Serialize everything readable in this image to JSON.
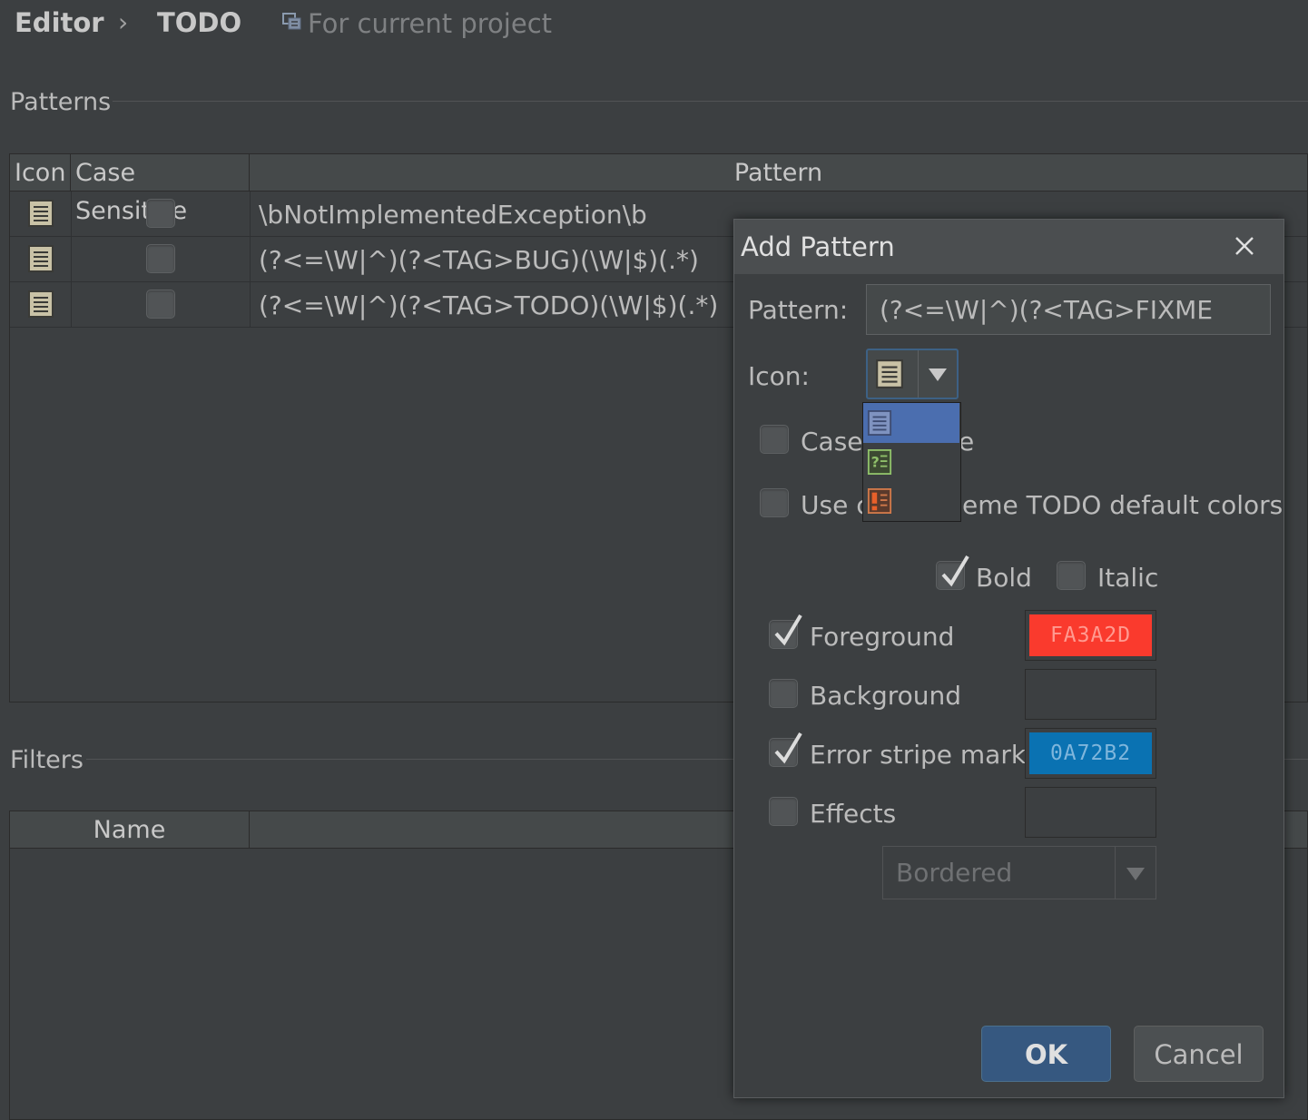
{
  "breadcrumb": {
    "parent": "Editor",
    "separator": "›",
    "current": "TODO",
    "scope": "For current project"
  },
  "patterns": {
    "title": "Patterns",
    "columns": {
      "icon": "Icon",
      "case_sensitive": "Case Sensitive",
      "pattern": "Pattern"
    },
    "rows": [
      {
        "icon": "todo-note-icon",
        "case_sensitive": false,
        "pattern": "\\bNotImplementedException\\b"
      },
      {
        "icon": "todo-note-icon",
        "case_sensitive": false,
        "pattern": "(?<=\\W|^)(?<TAG>BUG)(\\W|$)(.*)"
      },
      {
        "icon": "todo-note-icon",
        "case_sensitive": false,
        "pattern": "(?<=\\W|^)(?<TAG>TODO)(\\W|$)(.*)"
      }
    ]
  },
  "filters": {
    "title": "Filters",
    "columns": {
      "name": "Name"
    }
  },
  "dialog": {
    "title": "Add Pattern",
    "pattern_label": "Pattern:",
    "pattern_value": "(?<=\\W|^)(?<TAG>FIXME",
    "icon_label": "Icon:",
    "icon_options": [
      "todo-note-icon",
      "question-note-icon",
      "exclamation-note-icon"
    ],
    "case_sensitive_label": "Case",
    "case_sensitive_label_tail": "e",
    "use_colors_label": "Use c",
    "use_colors_label_tail": "eme TODO default colors",
    "bold_label": "Bold",
    "italic_label": "Italic",
    "foreground_label": "Foreground",
    "foreground_color": "FA3A2D",
    "background_label": "Background",
    "error_stripe_label": "Error stripe mark",
    "error_stripe_color": "0A72B2",
    "effects_label": "Effects",
    "effects_type": "Bordered",
    "ok_label": "OK",
    "cancel_label": "Cancel"
  },
  "colors": {
    "foreground_swatch": "#FA3A2D",
    "error_stripe_swatch": "#0A72B2",
    "selection": "#4B6EAF",
    "ok_button": "#365880"
  }
}
